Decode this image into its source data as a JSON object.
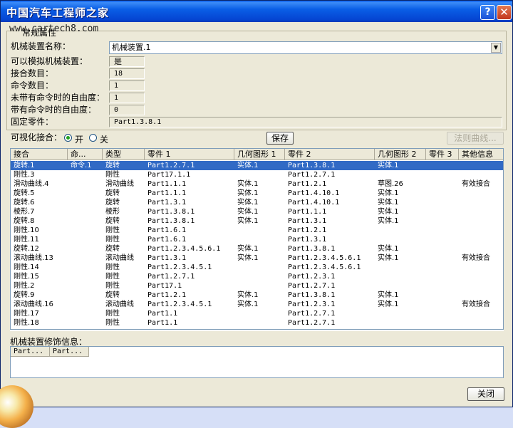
{
  "window": {
    "title": "中国汽车工程师之家",
    "help_button": "?",
    "close_button": "✕"
  },
  "watermark": "www.cartech8.com",
  "general": {
    "group_title": "常规属性",
    "mechanism_name_label": "机械装置名称：",
    "mechanism_name_value": "机械装置.1",
    "can_simulate_label": "可以模拟机械装置：",
    "can_simulate_value": "是",
    "joint_count_label": "接合数目：",
    "joint_count_value": "18",
    "command_count_label": "命令数目：",
    "command_count_value": "1",
    "dof_without_label": "未带有命令时的自由度：",
    "dof_without_value": "1",
    "dof_with_label": "带有命令时的自由度：",
    "dof_with_value": "0",
    "fixed_part_label": "固定零件：",
    "fixed_part_value": "Part1.3.8.1"
  },
  "visualize": {
    "label": "可视化接合：",
    "on_label": "开",
    "off_label": "关",
    "selected": "on"
  },
  "buttons": {
    "save": "保存",
    "normal_curve": "法则曲线...",
    "close": "关闭"
  },
  "table": {
    "columns": [
      "接合",
      "命...",
      "类型",
      "零件 1",
      "几何图形 1",
      "零件 2",
      "几何图形 2",
      "零件 3",
      "其他信息"
    ],
    "rows": [
      [
        "旋转.1",
        "命令.1",
        "旋转",
        "Part1.2.7.1",
        "实体.1",
        "Part1.3.8.1",
        "实体.1",
        "",
        ""
      ],
      [
        "刚性.3",
        "",
        "刚性",
        "Part17.1.1",
        "",
        "Part1.2.7.1",
        "",
        "",
        ""
      ],
      [
        "滑动曲线.4",
        "",
        "滑动曲线",
        "Part1.1.1",
        "实体.1",
        "Part1.2.1",
        "草图.26",
        "",
        "有效接合"
      ],
      [
        "旋转.5",
        "",
        "旋转",
        "Part1.1.1",
        "实体.1",
        "Part1.4.10.1",
        "实体.1",
        "",
        ""
      ],
      [
        "旋转.6",
        "",
        "旋转",
        "Part1.3.1",
        "实体.1",
        "Part1.4.10.1",
        "实体.1",
        "",
        ""
      ],
      [
        "棱形.7",
        "",
        "棱形",
        "Part1.3.8.1",
        "实体.1",
        "Part1.1.1",
        "实体.1",
        "",
        ""
      ],
      [
        "旋转.8",
        "",
        "旋转",
        "Part1.3.8.1",
        "实体.1",
        "Part1.3.1",
        "实体.1",
        "",
        ""
      ],
      [
        "刚性.10",
        "",
        "刚性",
        "Part1.6.1",
        "",
        "Part1.2.1",
        "",
        "",
        ""
      ],
      [
        "刚性.11",
        "",
        "刚性",
        "Part1.6.1",
        "",
        "Part1.3.1",
        "",
        "",
        ""
      ],
      [
        "旋转.12",
        "",
        "旋转",
        "Part1.2.3.4.5.6.1",
        "实体.1",
        "Part1.3.8.1",
        "实体.1",
        "",
        ""
      ],
      [
        "滚动曲线.13",
        "",
        "滚动曲线",
        "Part1.3.1",
        "实体.1",
        "Part1.2.3.4.5.6.1",
        "实体.1",
        "",
        "有效接合"
      ],
      [
        "刚性.14",
        "",
        "刚性",
        "Part1.2.3.4.5.1",
        "",
        "Part1.2.3.4.5.6.1",
        "",
        "",
        ""
      ],
      [
        "刚性.15",
        "",
        "刚性",
        "Part1.2.7.1",
        "",
        "Part1.2.3.1",
        "",
        "",
        ""
      ],
      [
        "刚性.2",
        "",
        "刚性",
        "Part17.1",
        "",
        "Part1.2.7.1",
        "",
        "",
        ""
      ],
      [
        "旋转.9",
        "",
        "旋转",
        "Part1.2.1",
        "实体.1",
        "Part1.3.8.1",
        "实体.1",
        "",
        ""
      ],
      [
        "滚动曲线.16",
        "",
        "滚动曲线",
        "Part1.2.3.4.5.1",
        "实体.1",
        "Part1.2.3.1",
        "实体.1",
        "",
        "有效接合"
      ],
      [
        "刚性.17",
        "",
        "刚性",
        "Part1.1",
        "",
        "Part1.2.7.1",
        "",
        "",
        ""
      ],
      [
        "刚性.18",
        "",
        "刚性",
        "Part1.1",
        "",
        "Part1.2.7.1",
        "",
        "",
        ""
      ]
    ],
    "selected_row": 0
  },
  "decoration_info": {
    "label": "机械装置修饰信息：",
    "columns": [
      "Part...",
      "Part..."
    ]
  }
}
